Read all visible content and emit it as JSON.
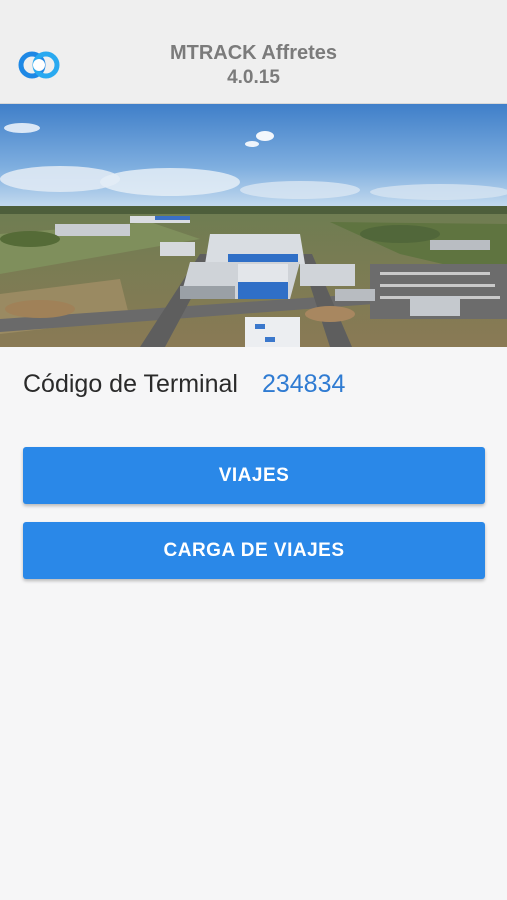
{
  "header": {
    "app_title": "MTRACK Affretes",
    "app_version": "4.0.15",
    "logo_icon": "mtrack-logo-icon"
  },
  "hero": {
    "image": "aerial-warehouse-photo"
  },
  "terminal": {
    "label": "Código de Terminal",
    "code": "234834"
  },
  "buttons": {
    "viajes_label": "VIAJES",
    "carga_label": "CARGA DE VIAJES"
  },
  "colors": {
    "accent": "#2a88e8",
    "code_text": "#2f7bd2",
    "header_bg": "#efefef",
    "page_bg": "#f6f6f7"
  }
}
